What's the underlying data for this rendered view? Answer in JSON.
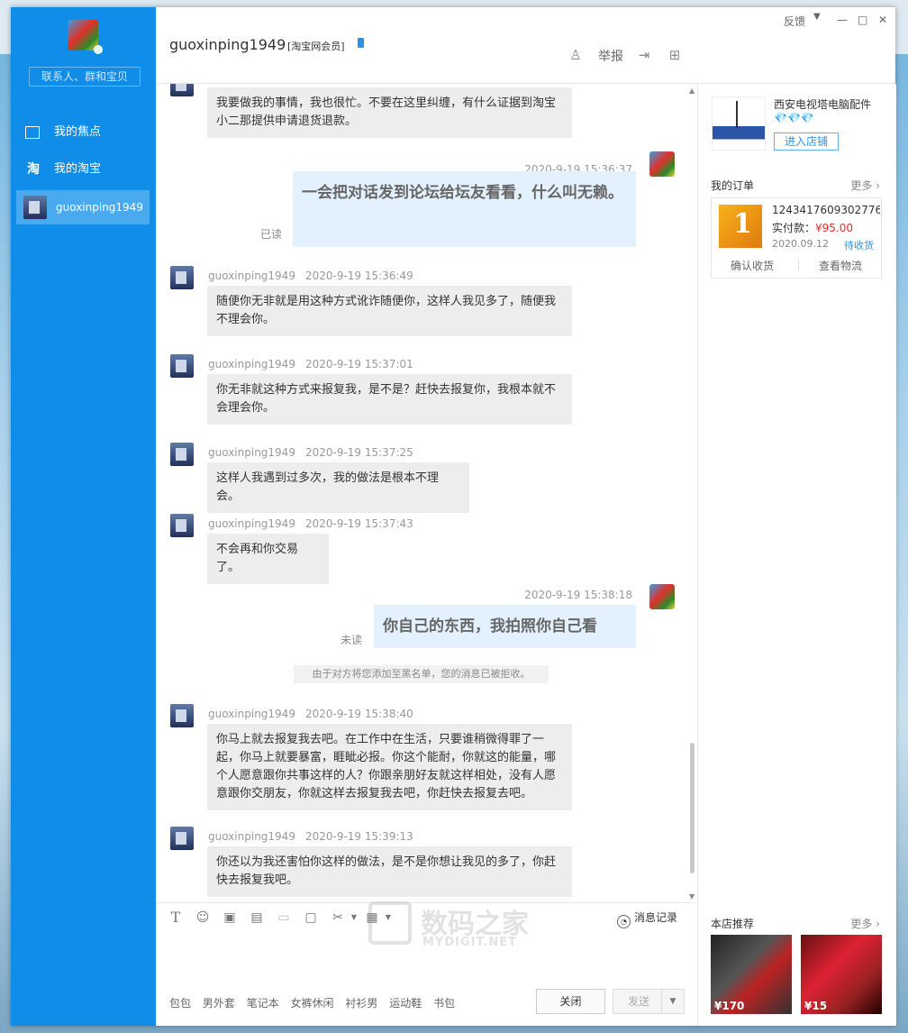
{
  "sidebar": {
    "search_placeholder": "联系人、群和宝贝",
    "items": [
      {
        "label": "我的焦点"
      },
      {
        "label": "我的淘宝"
      },
      {
        "label": "guoxinping1949"
      }
    ],
    "taobao_glyph": "淘"
  },
  "header": {
    "contact_name": "guoxinping1949",
    "member_tag": "[淘宝网会员]",
    "feedback": "反馈",
    "report": "举报"
  },
  "messages": {
    "m0": {
      "text": "我要做我的事情，我也很忙。不要在这里纠缠，有什么证据到淘宝小二那提供申请退货退款。"
    },
    "m1": {
      "time": "2020-9-19 15:36:37",
      "text": "一会把对话发到论坛给坛友看看，什么叫无赖。",
      "status": "已读"
    },
    "m2": {
      "sender": "guoxinping1949",
      "time": "2020-9-19 15:36:49",
      "text": "随便你无非就是用这种方式讹诈随便你，这样人我见多了，随便我不理会你。"
    },
    "m3": {
      "sender": "guoxinping1949",
      "time": "2020-9-19 15:37:01",
      "text": "你无非就这种方式来报复我，是不是？赶快去报复你，我根本就不会理会你。"
    },
    "m4": {
      "sender": "guoxinping1949",
      "time": "2020-9-19 15:37:25",
      "text": "这样人我遇到过多次，我的做法是根本不理会。"
    },
    "m5": {
      "sender": "guoxinping1949",
      "time": "2020-9-19 15:37:43",
      "text": "不会再和你交易了。"
    },
    "m6": {
      "time": "2020-9-19 15:38:18",
      "text": "你自己的东西，我拍照你自己看",
      "status": "未读"
    },
    "system": "由于对方将您添加至黑名单，您的消息已被拒收。",
    "m7": {
      "sender": "guoxinping1949",
      "time": "2020-9-19 15:38:40",
      "text": "你马上就去报复我去吧。在工作中在生活，只要谁稍微得罪了一起，你马上就要暴富，睚眦必报。你这个能耐，你就这的能量，哪个人愿意跟你共事这样的人？你跟亲朋好友就这样相处，没有人愿意跟你交朋友，你就这样去报复我去吧，你赶快去报复去吧。"
    },
    "m8": {
      "sender": "guoxinping1949",
      "time": "2020-9-19 15:39:13",
      "text": "你还以为我还害怕你这样的做法，是不是你想让我见的多了，你赶快去报复我吧。"
    }
  },
  "toolbar": {
    "history_label": "消息记录"
  },
  "tags": [
    "包包",
    "男外套",
    "笔记本",
    "女裤休闲",
    "衬衫男",
    "运动鞋",
    "书包"
  ],
  "buttons": {
    "close": "关闭",
    "send": "发送"
  },
  "right": {
    "shop_name": "西安电视塔电脑配件",
    "diamonds": "💎💎💎",
    "enter_shop": "进入店铺",
    "orders_title": "我的订单",
    "more": "更多",
    "order": {
      "number": "1243417609302776",
      "pay_label": "实付款：",
      "pay_amount": "¥95.00",
      "date": "2020.09.12",
      "status": "待收货",
      "confirm": "确认收货",
      "logistics": "查看物流"
    },
    "recommend_title": "本店推荐",
    "recommend": [
      {
        "price": "¥170"
      },
      {
        "price": "¥15"
      }
    ]
  },
  "watermark": {
    "big": "数码之家",
    "small": "MYDIGIT.NET"
  }
}
